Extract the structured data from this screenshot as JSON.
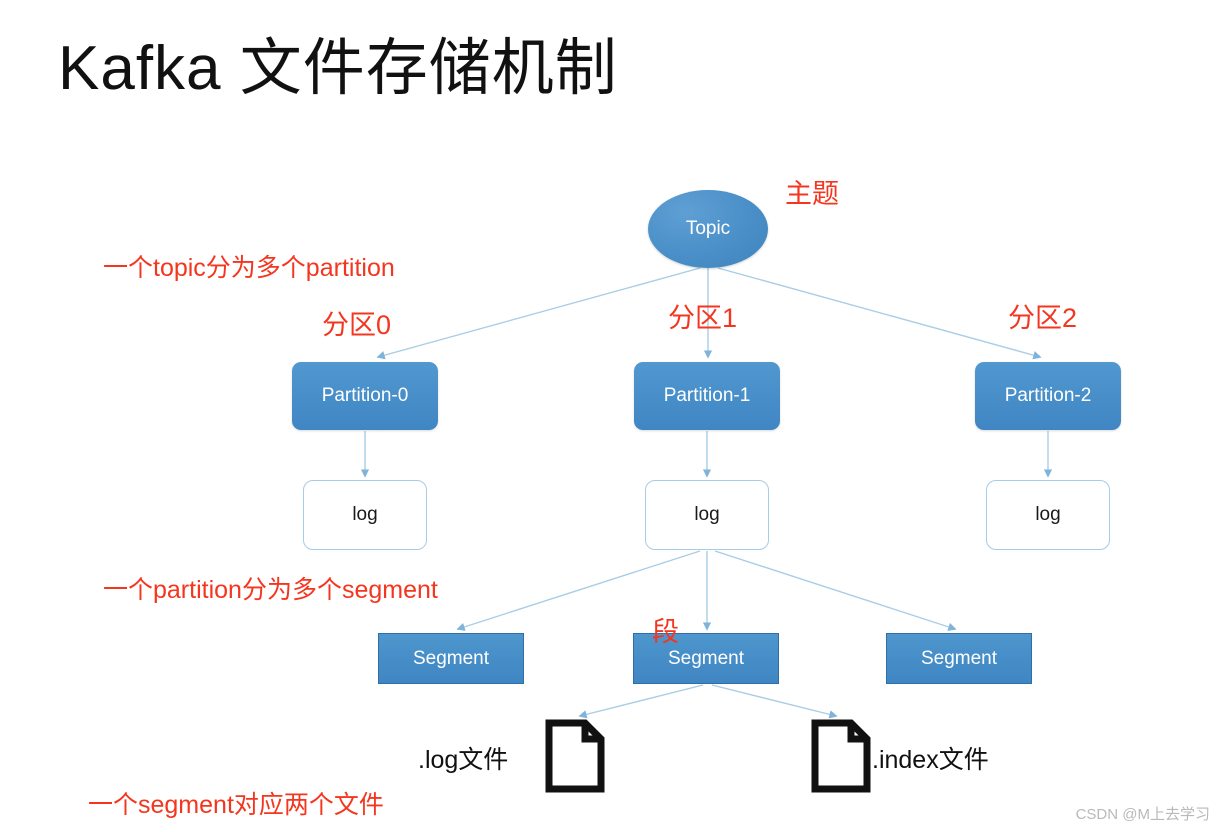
{
  "page": {
    "title": "Kafka 文件存储机制",
    "background_color": "#ffffff",
    "accent_blue": "#4189c4",
    "annotation_red": "#f4361f",
    "edge_color": "#9dc3e0"
  },
  "nodes": {
    "topic": {
      "label": "Topic",
      "shape": "ellipse",
      "fill": "#4a8fc8",
      "text_color": "#ffffff"
    },
    "partitions": [
      {
        "label": "Partition-0"
      },
      {
        "label": "Partition-1"
      },
      {
        "label": "Partition-2"
      }
    ],
    "logs": [
      {
        "label": "log"
      },
      {
        "label": "log"
      },
      {
        "label": "log"
      }
    ],
    "segments": [
      {
        "label": "Segment"
      },
      {
        "label": "Segment"
      },
      {
        "label": "Segment"
      }
    ],
    "files": [
      {
        "label": ".log文件",
        "icon": "document-icon"
      },
      {
        "label": ".index文件",
        "icon": "document-icon"
      }
    ]
  },
  "annotations": {
    "topic_note": "主题",
    "partition_note": "一个topic分为多个partition",
    "partition_labels": [
      "分区0",
      "分区1",
      "分区2"
    ],
    "segment_note": "一个partition分为多个segment",
    "segment_label": "段",
    "file_note": "一个segment对应两个文件"
  },
  "watermark": {
    "text": "CSDN @M上去学习"
  }
}
